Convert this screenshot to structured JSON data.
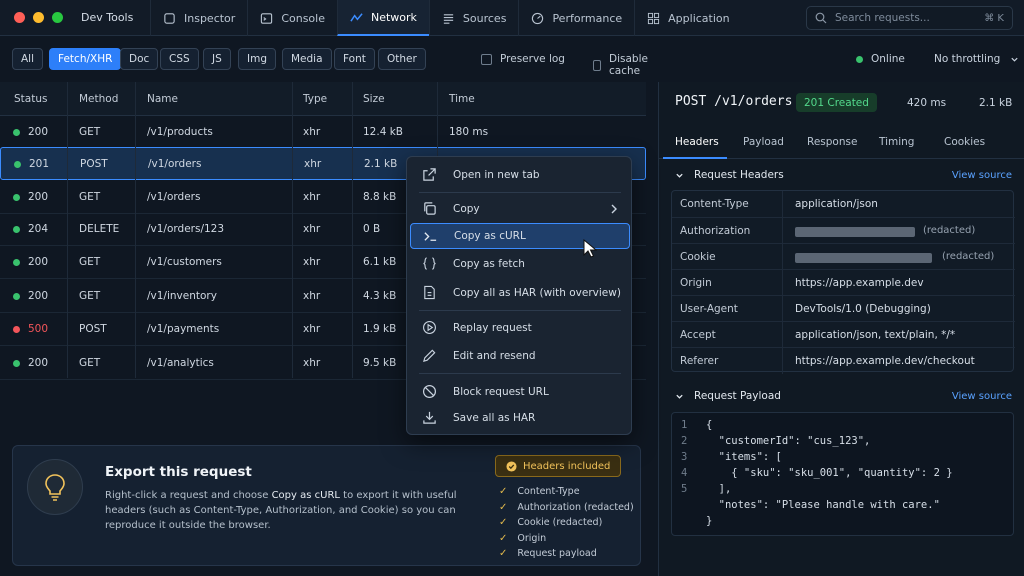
{
  "window": {
    "app_title": "Dev Tools",
    "traffic_colors": [
      "#ff5f57",
      "#febc2e",
      "#28c840"
    ]
  },
  "tabs": [
    {
      "label": "Inspector",
      "icon": "cursor-icon"
    },
    {
      "label": "Console",
      "icon": "console-icon"
    },
    {
      "label": "Network",
      "icon": "network-icon",
      "active": true
    },
    {
      "label": "Sources",
      "icon": "sources-icon"
    },
    {
      "label": "Performance",
      "icon": "performance-icon"
    },
    {
      "label": "Application",
      "icon": "application-icon"
    }
  ],
  "search": {
    "placeholder": "Search requests...",
    "shortcut": "⌘ K"
  },
  "filters": {
    "chips": [
      "All",
      "Fetch/XHR",
      "Doc",
      "CSS",
      "JS",
      "Img",
      "Media",
      "Font",
      "Other"
    ],
    "active": "Fetch/XHR",
    "preserve_log": "Preserve log",
    "disable_cache": "Disable cache",
    "online": "Online",
    "throttling": "No throttling"
  },
  "table": {
    "headers": [
      "Status",
      "Method",
      "Name",
      "Type",
      "Size",
      "Time"
    ],
    "rows": [
      {
        "status": "200",
        "method": "GET",
        "name": "/v1/products",
        "type": "xhr",
        "size": "12.4 kB",
        "time": "180 ms",
        "color": "#39c26d"
      },
      {
        "status": "201",
        "method": "POST",
        "name": "/v1/orders",
        "type": "xhr",
        "size": "2.1 kB",
        "time": "",
        "color": "#39c26d",
        "selected": true
      },
      {
        "status": "200",
        "method": "GET",
        "name": "/v1/orders",
        "type": "xhr",
        "size": "8.8 kB",
        "time": "",
        "color": "#39c26d"
      },
      {
        "status": "204",
        "method": "DELETE",
        "name": "/v1/orders/123",
        "type": "xhr",
        "size": "0 B",
        "time": "",
        "color": "#39c26d"
      },
      {
        "status": "200",
        "method": "GET",
        "name": "/v1/customers",
        "type": "xhr",
        "size": "6.1 kB",
        "time": "",
        "color": "#39c26d"
      },
      {
        "status": "200",
        "method": "GET",
        "name": "/v1/inventory",
        "type": "xhr",
        "size": "4.3 kB",
        "time": "",
        "color": "#39c26d"
      },
      {
        "status": "500",
        "method": "POST",
        "name": "/v1/payments",
        "type": "xhr",
        "size": "1.9 kB",
        "time": "",
        "color": "#f2555a"
      },
      {
        "status": "200",
        "method": "GET",
        "name": "/v1/analytics",
        "type": "xhr",
        "size": "9.5 kB",
        "time": "",
        "color": "#39c26d"
      }
    ]
  },
  "context_menu": {
    "items": [
      {
        "label": "Open in new tab",
        "icon": "open-external-icon"
      },
      {
        "label": "Copy",
        "icon": "copy-icon",
        "submenu": true
      },
      {
        "label": "Copy as cURL",
        "icon": "terminal-icon",
        "highlighted": true
      },
      {
        "label": "Copy as fetch",
        "icon": "braces-icon"
      },
      {
        "label": "Copy all as HAR (with overview)",
        "icon": "document-icon"
      },
      {
        "label": "Replay request",
        "icon": "replay-icon"
      },
      {
        "label": "Edit and resend",
        "icon": "pencil-icon"
      },
      {
        "label": "Block request URL",
        "icon": "block-icon"
      },
      {
        "label": "Save all as HAR",
        "icon": "download-icon"
      }
    ]
  },
  "detail": {
    "title": "POST /v1/orders",
    "status_badge": "201 Created",
    "time": "420 ms",
    "size": "2.1 kB",
    "tabs": [
      "Headers",
      "Payload",
      "Response",
      "Timing",
      "Cookies"
    ],
    "active_tab": "Headers",
    "request_headers": {
      "title": "Request Headers",
      "view_source": "View source",
      "rows": [
        {
          "key": "Content-Type",
          "value": "application/json"
        },
        {
          "key": "Authorization",
          "value": "(redacted)",
          "redacted": true
        },
        {
          "key": "Cookie",
          "value": "(redacted)",
          "redacted": true
        },
        {
          "key": "Origin",
          "value": "https://app.example.dev"
        },
        {
          "key": "User-Agent",
          "value": "DevTools/1.0 (Debugging)"
        },
        {
          "key": "Accept",
          "value": "application/json, text/plain, */*"
        },
        {
          "key": "Referer",
          "value": "https://app.example.dev/checkout"
        }
      ]
    },
    "request_payload": {
      "title": "Request Payload",
      "view_source": "View source",
      "line_numbers": [
        "1",
        "2",
        "3",
        "4",
        "5"
      ],
      "lines": [
        "{",
        "  \"customerId\": \"cus_123\",",
        "  \"items\": [",
        "    { \"sku\": \"sku_001\", \"quantity\": 2 }",
        "  ],",
        "  \"notes\": \"Please handle with care.\"",
        "}"
      ]
    }
  },
  "export_card": {
    "title": "Export this request",
    "body_pre": "Right-click a request and choose ",
    "body_em": "Copy as cURL",
    "body_post": " to export it with useful headers (such as Content-Type, Authorization, and Cookie) so you can reproduce it outside the browser.",
    "badge": "Headers included",
    "checklist": [
      "Content-Type",
      "Authorization (redacted)",
      "Cookie (redacted)",
      "Origin",
      "Request payload"
    ]
  }
}
